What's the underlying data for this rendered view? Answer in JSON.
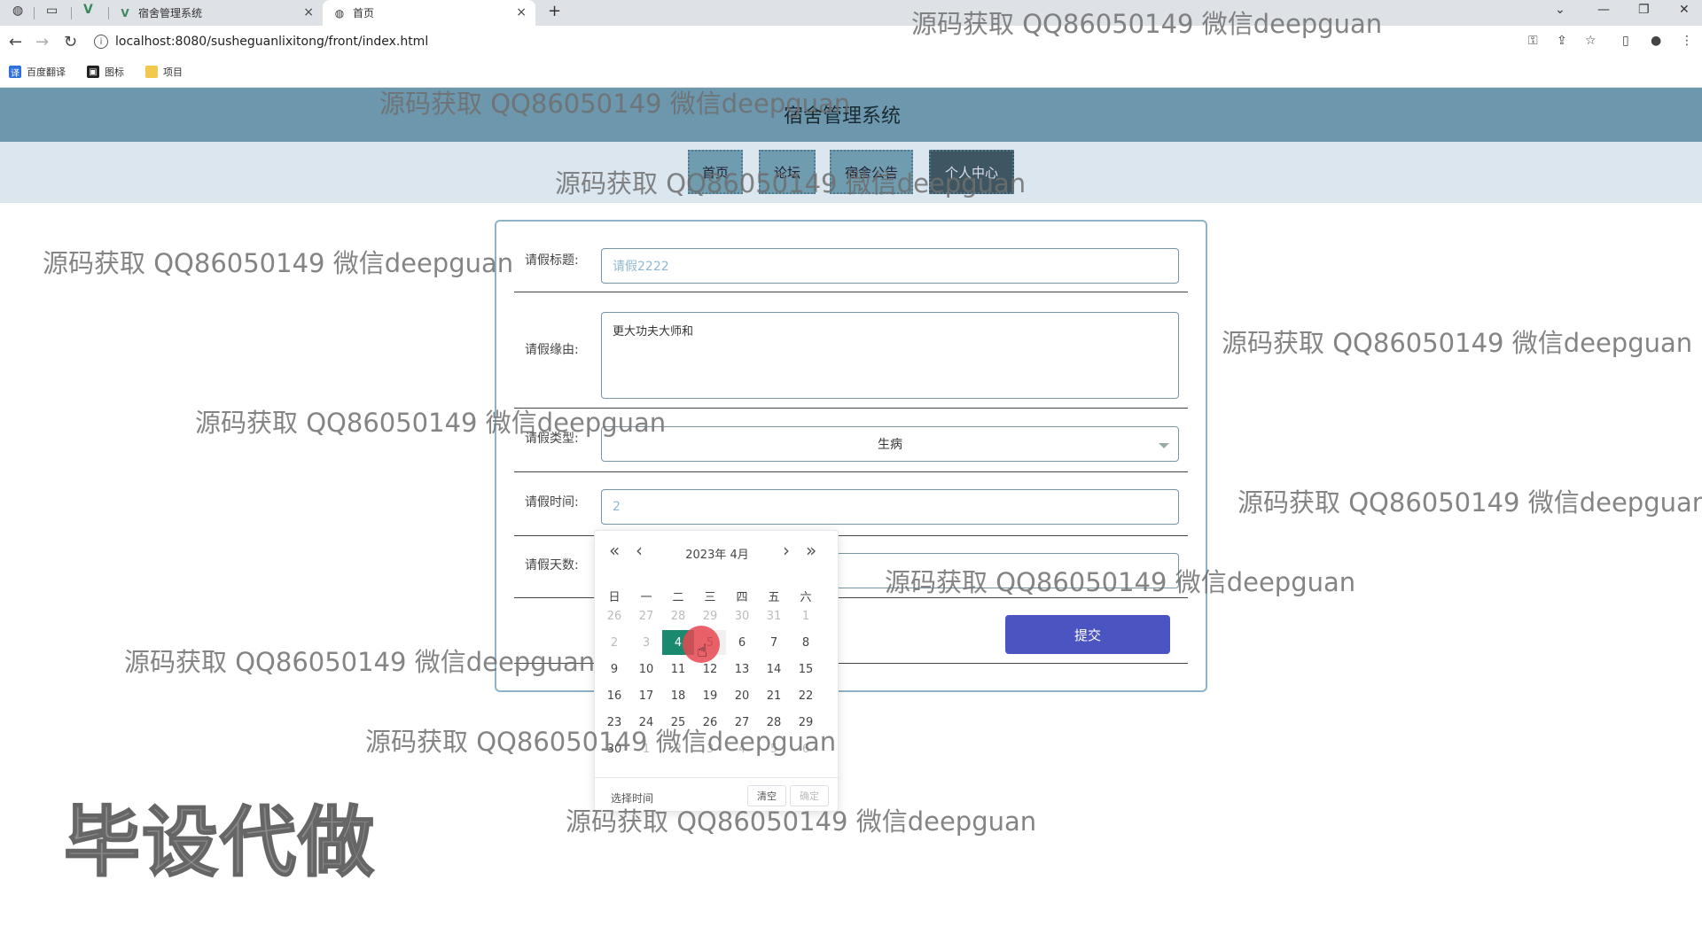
{
  "browser": {
    "tabs": [
      {
        "title": "宿舍管理系统",
        "active": false
      },
      {
        "title": "首页",
        "active": true
      }
    ],
    "new_tab_symbol": "+",
    "url": "localhost:8080/susheguanlixitong/front/index.html",
    "bookmarks": [
      {
        "label": "百度翻译",
        "icon": "translate-icon",
        "color": "#2f6fde"
      },
      {
        "label": "图标",
        "icon": "image-icon",
        "color": "#222222"
      },
      {
        "label": "项目",
        "icon": "folder-icon",
        "color": "#f2c94c"
      }
    ]
  },
  "site": {
    "title": "宿舍管理系统",
    "nav": [
      {
        "label": "首页",
        "active": false
      },
      {
        "label": "论坛",
        "active": false
      },
      {
        "label": "宿舍公告",
        "active": false
      },
      {
        "label": "个人中心",
        "active": true
      }
    ]
  },
  "form": {
    "title_label": "请假标题:",
    "title_value": "请假2222",
    "reason_label": "请假缘由:",
    "reason_value": "更大功夫大师和",
    "type_label": "请假类型:",
    "type_value": "生病",
    "time_label": "请假时间:",
    "time_value": "2",
    "days_label": "请假天数:",
    "days_value": "",
    "submit_label": "提交"
  },
  "datepicker": {
    "title": "2023年  4月",
    "weekdays": [
      "日",
      "一",
      "二",
      "三",
      "四",
      "五",
      "六"
    ],
    "weeks": [
      [
        "26",
        "27",
        "28",
        "29",
        "30",
        "31",
        "1"
      ],
      [
        "2",
        "3",
        "4",
        "5",
        "6",
        "7",
        "8"
      ],
      [
        "9",
        "10",
        "11",
        "12",
        "13",
        "14",
        "15"
      ],
      [
        "16",
        "17",
        "18",
        "19",
        "20",
        "21",
        "22"
      ],
      [
        "23",
        "24",
        "25",
        "26",
        "27",
        "28",
        "29"
      ],
      [
        "30",
        "1",
        "2",
        "3",
        "4",
        "5",
        "6"
      ]
    ],
    "selected_day": "4",
    "footer_label": "选择时间",
    "clear_label": "清空",
    "confirm_label": "确定"
  },
  "watermarks": {
    "text": "源码获取 QQ86050149 微信deepguan",
    "big_text": "毕设代做"
  },
  "colors": {
    "header": "#6d97ac",
    "nav_strip": "#dbe6ee",
    "submit": "#4a55c2",
    "selected_day": "#1a8a6e"
  }
}
